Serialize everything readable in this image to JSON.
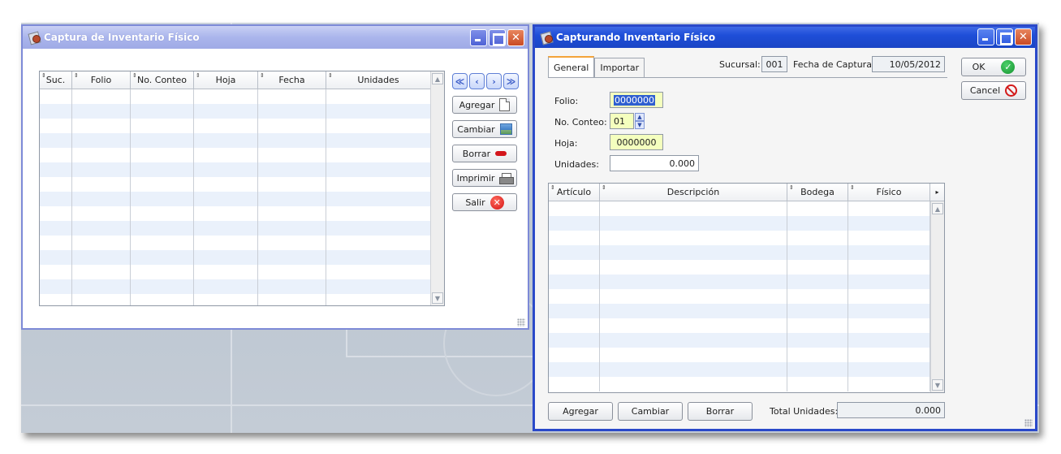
{
  "window1": {
    "title": "Captura de Inventario Físico",
    "columns": [
      "Suc.",
      "Folio",
      "No. Conteo",
      "Hoja",
      "Fecha",
      "Unidades"
    ],
    "buttons": {
      "agregar": "Agregar",
      "cambiar": "Cambiar",
      "borrar": "Borrar",
      "imprimir": "Imprimir",
      "salir": "Salir"
    },
    "nav": {
      "first": "≪",
      "prev": "‹",
      "next": "›",
      "last": "≫"
    }
  },
  "window2": {
    "title": "Capturando Inventario Físico",
    "tabs": [
      "General",
      "Importar"
    ],
    "sucursal_label": "Sucursal:",
    "sucursal_value": "001",
    "fecha_label": "Fecha de Captura:",
    "fecha_value": "10/05/2012",
    "folio_label": "Folio:",
    "folio_value": "0000000",
    "conteo_label": "No. Conteo:",
    "conteo_value": "01",
    "hoja_label": "Hoja:",
    "hoja_value": "0000000",
    "unidades_label": "Unidades:",
    "unidades_value": "0.000",
    "columns": [
      "Artículo",
      "Descripción",
      "Bodega",
      "Físico"
    ],
    "ok_label": "OK",
    "cancel_label": "Cancel",
    "agregar": "Agregar",
    "cambiar": "Cambiar",
    "borrar": "Borrar",
    "total_label": "Total Unidades:",
    "total_value": "0.000"
  },
  "colors": {
    "window1_title": "#aab5ec",
    "window2_title": "#1e4ed8",
    "row_alt": "#eaf1fb",
    "field_highlight": "#f4ffbe"
  },
  "icons": {
    "agregar": "new-document-icon",
    "cambiar": "edit-image-icon",
    "borrar": "minus-icon",
    "imprimir": "printer-icon",
    "salir": "close-circle-icon",
    "ok": "check-circle-icon",
    "cancel": "no-entry-icon"
  }
}
